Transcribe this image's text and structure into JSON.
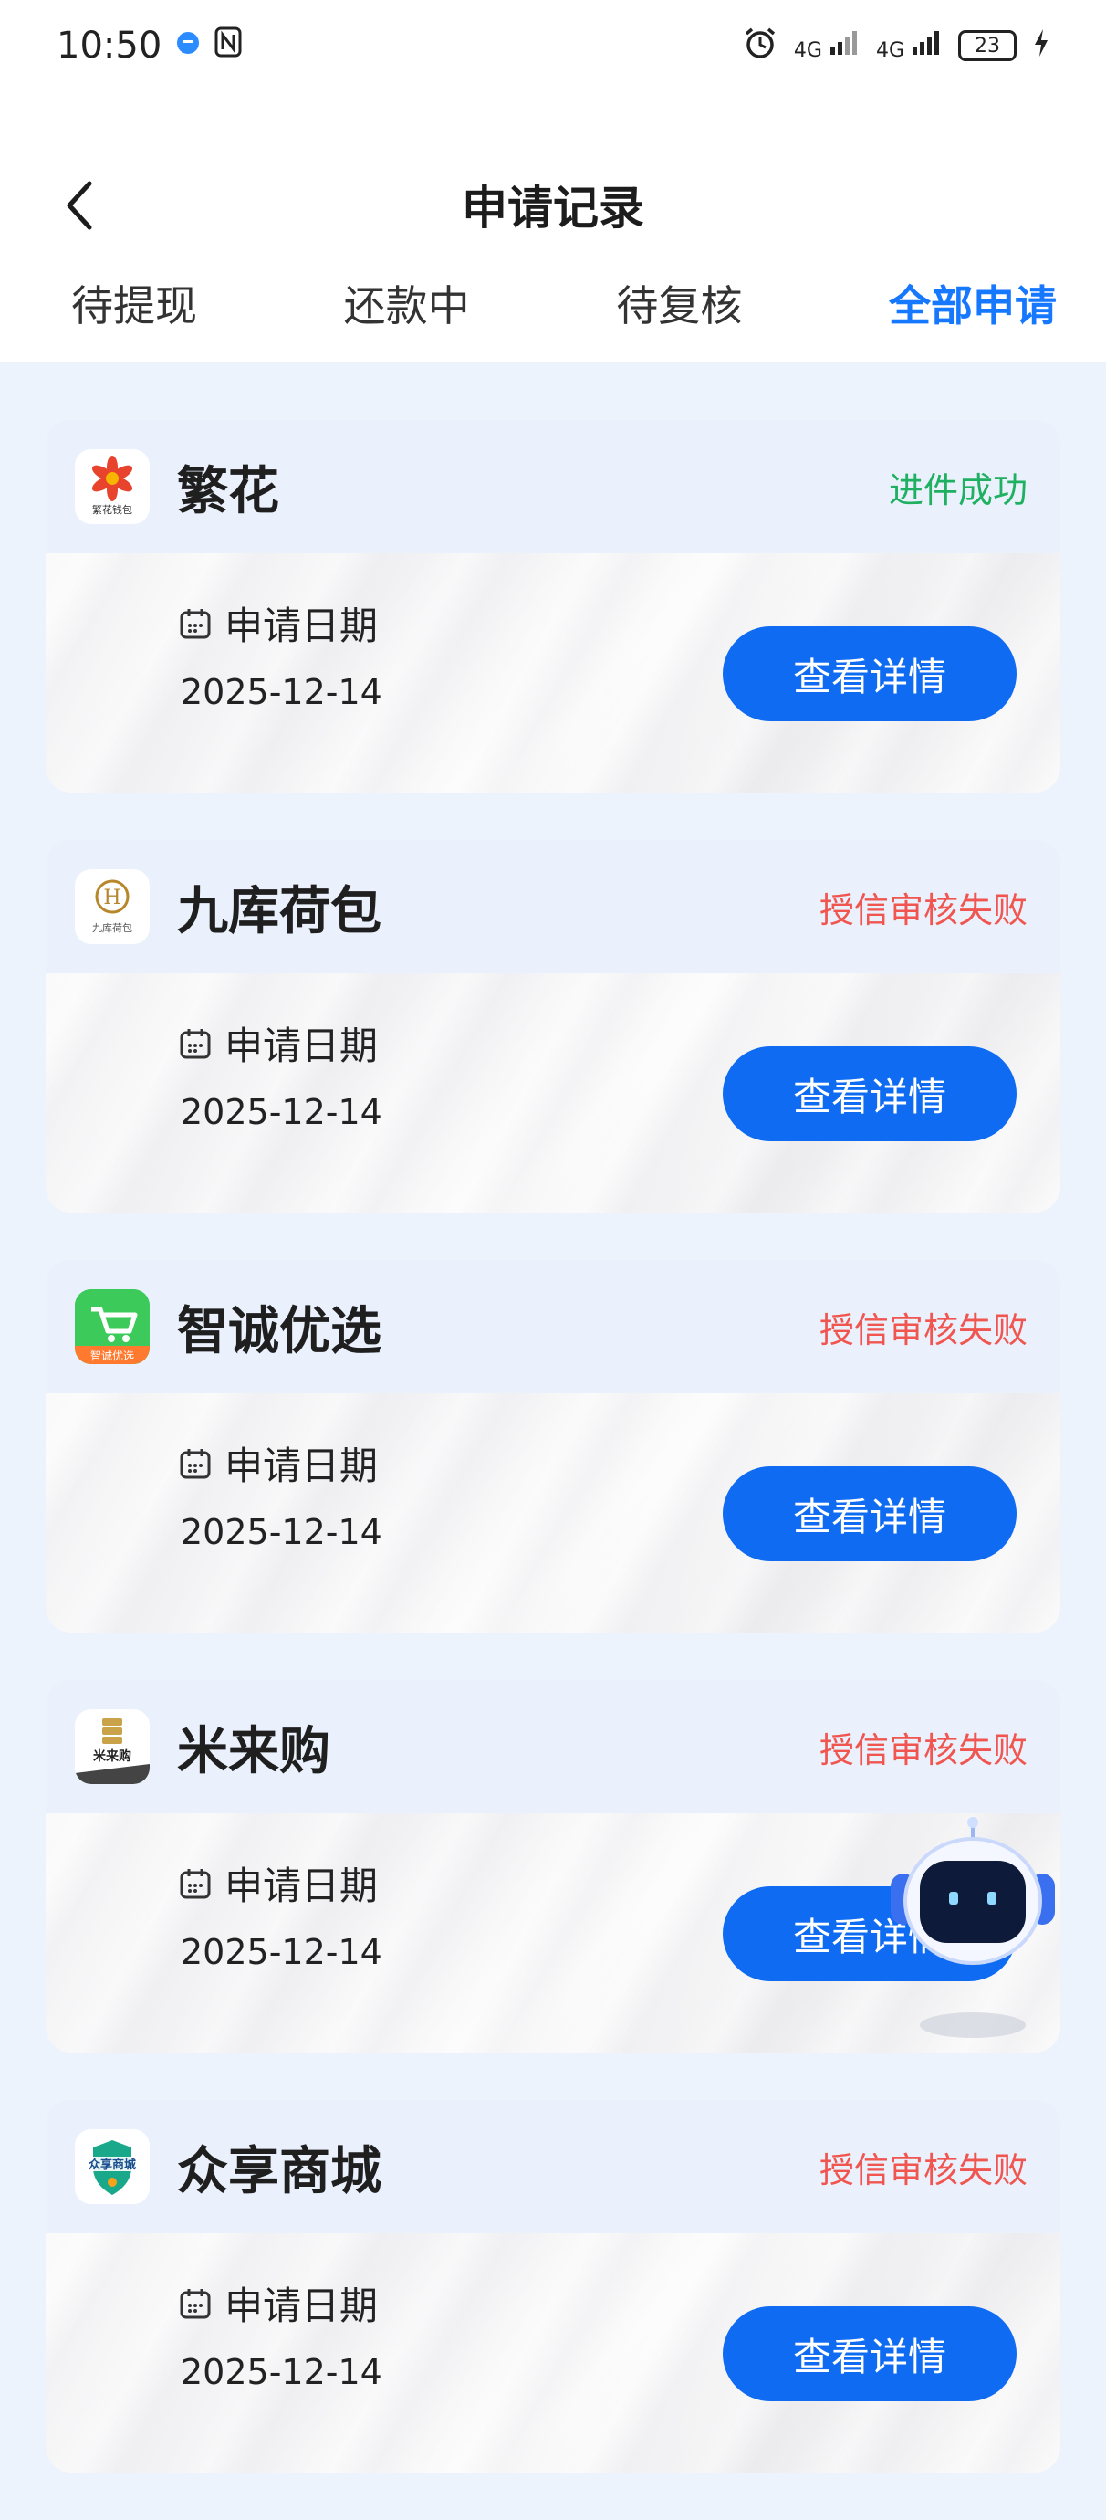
{
  "status_bar": {
    "time": "10:50",
    "signal_1": "4G",
    "signal_2": "4G",
    "battery": "23"
  },
  "header": {
    "title": "申请记录",
    "tabs": [
      {
        "label": "待提现",
        "active": false
      },
      {
        "label": "还款中",
        "active": false
      },
      {
        "label": "待复核",
        "active": false
      },
      {
        "label": "全部申请",
        "active": true
      }
    ]
  },
  "records": [
    {
      "name": "繁花",
      "status": "进件成功",
      "status_color": "#20b061",
      "date_label": "申请日期",
      "date": "2025-12-14",
      "button": "查看详情",
      "logo_text": "繁花钱包"
    },
    {
      "name": "九库荷包",
      "status": "授信审核失败",
      "status_color": "#f0554f",
      "date_label": "申请日期",
      "date": "2025-12-14",
      "button": "查看详情",
      "logo_text": "九库荷包"
    },
    {
      "name": "智诚优选",
      "status": "授信审核失败",
      "status_color": "#f0554f",
      "date_label": "申请日期",
      "date": "2025-12-14",
      "button": "查看详情",
      "logo_text": "智诚优选"
    },
    {
      "name": "米来购",
      "status": "授信审核失败",
      "status_color": "#f0554f",
      "date_label": "申请日期",
      "date": "2025-12-14",
      "button": "查看详情",
      "logo_text": "米来购"
    },
    {
      "name": "众享商城",
      "status": "授信审核失败",
      "status_color": "#f0554f",
      "date_label": "申请日期",
      "date": "2025-12-14",
      "button": "查看详情",
      "logo_text": "众享商城"
    }
  ],
  "colors": {
    "accent": "#1677ff",
    "button": "#0f6cf2",
    "success": "#20b061",
    "fail": "#f0554f"
  },
  "icons": {
    "back": "chevron-left-icon",
    "date": "calendar-icon",
    "assistant": "robot-assistant-icon"
  }
}
